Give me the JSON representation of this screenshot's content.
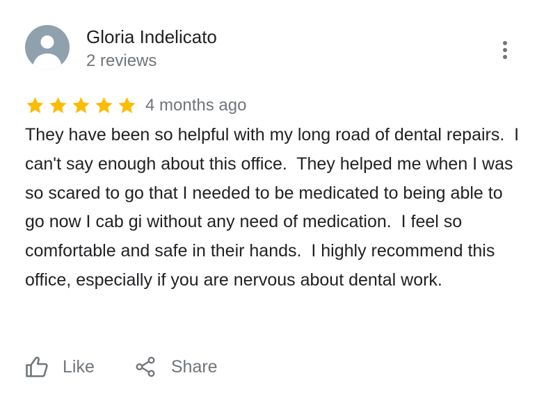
{
  "review": {
    "author": {
      "name": "Gloria Indelicato",
      "review_count": "2 reviews",
      "avatar_icon": "default-person-avatar",
      "avatar_color": "#8fa1ad"
    },
    "menu_icon": "more-vert-icon",
    "rating": {
      "stars": 5,
      "max_stars": 5,
      "star_color": "#fbbc04"
    },
    "date": "4 months ago",
    "text": "They have been so helpful with my long road of dental repairs.  I can't say enough about this office.  They helped me when I was so scared to go that I needed to be medicated to being able to go now I cab gi without any need of medication.  I feel so comfortable and safe in their hands.  I highly recommend this office, especially if you are nervous about dental work."
  },
  "actions": {
    "like_label": "Like",
    "like_icon": "thumb-up-icon",
    "share_label": "Share",
    "share_icon": "share-icon"
  },
  "colors": {
    "primary_text": "#202124",
    "secondary_text": "#70757a"
  }
}
